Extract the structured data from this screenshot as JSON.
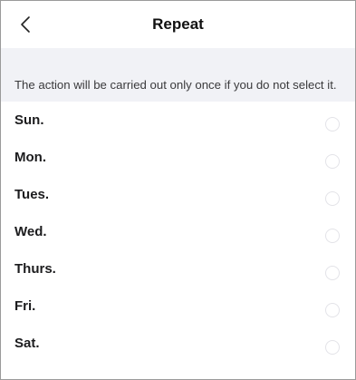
{
  "header": {
    "back_icon": "chevron-left-icon",
    "title": "Repeat"
  },
  "hint": {
    "text": "The action will be carried out only once if you do not select it."
  },
  "days": [
    {
      "label": "Sun.",
      "selected": false
    },
    {
      "label": "Mon.",
      "selected": false
    },
    {
      "label": "Tues.",
      "selected": false
    },
    {
      "label": "Wed.",
      "selected": false
    },
    {
      "label": "Thurs.",
      "selected": false
    },
    {
      "label": "Fri.",
      "selected": false
    },
    {
      "label": "Sat.",
      "selected": false
    }
  ],
  "colors": {
    "hint_background": "#f1f2f6",
    "radio_border": "#e3e3e8",
    "title": "#111111"
  }
}
